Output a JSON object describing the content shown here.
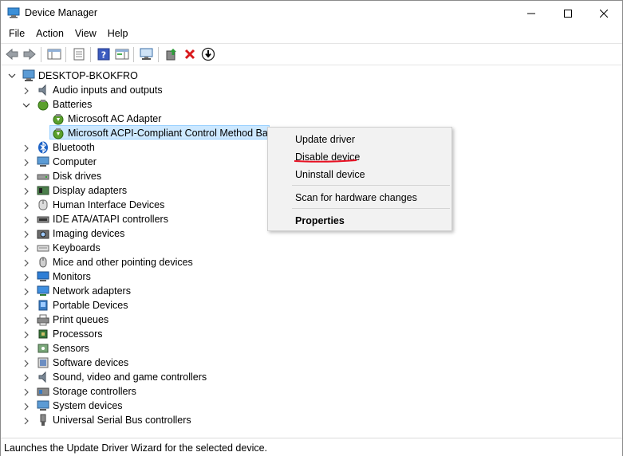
{
  "window": {
    "title": "Device Manager"
  },
  "menu": [
    "File",
    "Action",
    "View",
    "Help"
  ],
  "tree": {
    "root": "DESKTOP-BKOKFRO",
    "categories": [
      "Audio inputs and outputs",
      "Batteries",
      "Bluetooth",
      "Computer",
      "Disk drives",
      "Display adapters",
      "Human Interface Devices",
      "IDE ATA/ATAPI controllers",
      "Imaging devices",
      "Keyboards",
      "Mice and other pointing devices",
      "Monitors",
      "Network adapters",
      "Portable Devices",
      "Print queues",
      "Processors",
      "Sensors",
      "Software devices",
      "Sound, video and game controllers",
      "Storage controllers",
      "System devices",
      "Universal Serial Bus controllers"
    ],
    "battery_children": [
      "Microsoft AC Adapter",
      "Microsoft ACPI-Compliant Control Method Bat"
    ]
  },
  "context_menu": {
    "update": "Update driver",
    "disable": "Disable device",
    "uninstall": "Uninstall device",
    "scan": "Scan for hardware changes",
    "properties": "Properties"
  },
  "status": "Launches the Update Driver Wizard for the selected device.",
  "colors": {
    "selection": "#cce8ff",
    "annotation": "#e81123"
  }
}
